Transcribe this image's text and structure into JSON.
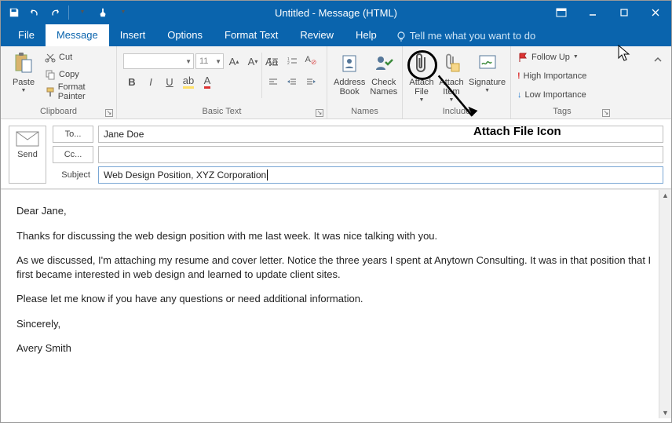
{
  "window": {
    "title": "Untitled  -  Message (HTML)"
  },
  "tabs": {
    "file": "File",
    "message": "Message",
    "insert": "Insert",
    "options": "Options",
    "format_text": "Format Text",
    "review": "Review",
    "help": "Help",
    "tell_me": "Tell me what you want to do"
  },
  "ribbon": {
    "clipboard": {
      "label": "Clipboard",
      "paste": "Paste",
      "cut": "Cut",
      "copy": "Copy",
      "format_painter": "Format Painter"
    },
    "basic_text": {
      "label": "Basic Text",
      "font_name": "",
      "font_size": "11"
    },
    "names": {
      "label": "Names",
      "address_book": "Address Book",
      "check_names": "Check Names"
    },
    "include": {
      "label": "Include",
      "attach_file": "Attach File",
      "attach_item": "Attach Item",
      "signature": "Signature"
    },
    "tags": {
      "label": "Tags",
      "follow_up": "Follow Up",
      "high_importance": "High Importance",
      "low_importance": "Low Importance"
    }
  },
  "fields": {
    "send": "Send",
    "to_label": "To...",
    "to_value": "Jane Doe",
    "cc_label": "Cc...",
    "cc_value": "",
    "subject_label": "Subject",
    "subject_value": "Web Design Position, XYZ Corporation"
  },
  "body": {
    "p1": "Dear Jane,",
    "p2": "Thanks for discussing the web design position with me last week. It was nice talking with you.",
    "p3": "As we discussed, I'm attaching my resume and cover letter. Notice the three years I spent at Anytown Consulting. It was in that position that I first became interested in web design and learned to update client sites.",
    "p4": "Please let me know if you have any questions or need additional information.",
    "p5": "Sincerely,",
    "p6": "Avery Smith"
  },
  "annotation": {
    "label": "Attach File Icon"
  }
}
